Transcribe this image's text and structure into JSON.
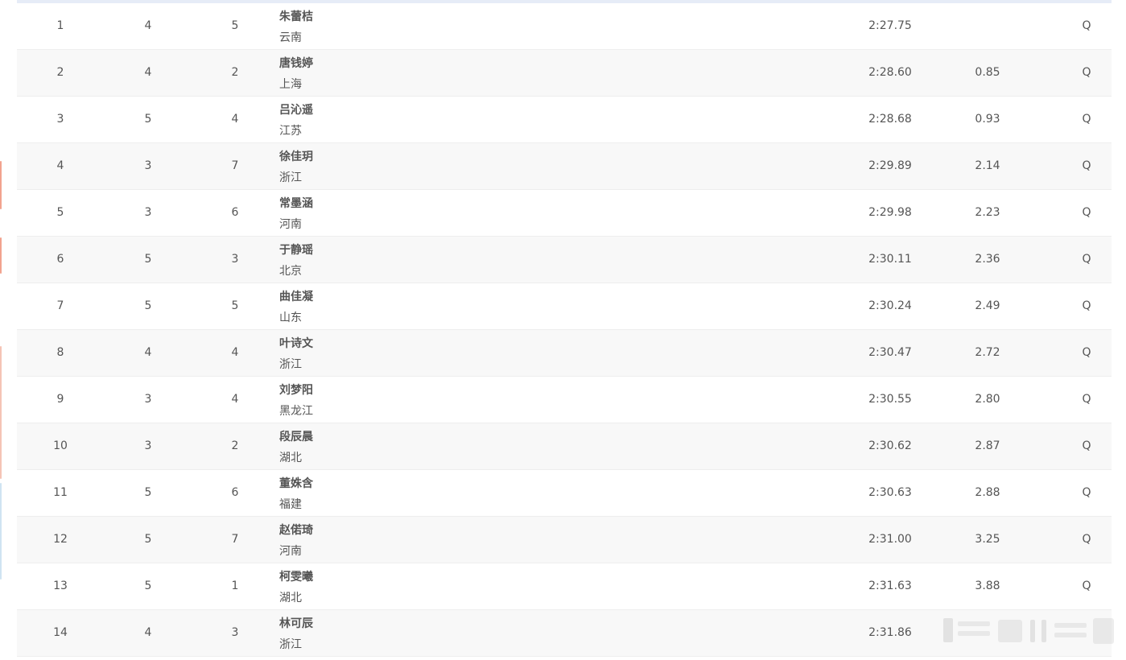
{
  "results": [
    {
      "rank": "1",
      "heat": "4",
      "lane": "5",
      "name": "朱蕾桔",
      "team": "云南",
      "time": "2:27.75",
      "diff": "",
      "qualify": "Q"
    },
    {
      "rank": "2",
      "heat": "4",
      "lane": "2",
      "name": "唐钱婷",
      "team": "上海",
      "time": "2:28.60",
      "diff": "0.85",
      "qualify": "Q"
    },
    {
      "rank": "3",
      "heat": "5",
      "lane": "4",
      "name": "吕沁遥",
      "team": "江苏",
      "time": "2:28.68",
      "diff": "0.93",
      "qualify": "Q"
    },
    {
      "rank": "4",
      "heat": "3",
      "lane": "7",
      "name": "徐佳玥",
      "team": "浙江",
      "time": "2:29.89",
      "diff": "2.14",
      "qualify": "Q"
    },
    {
      "rank": "5",
      "heat": "3",
      "lane": "6",
      "name": "常墨涵",
      "team": "河南",
      "time": "2:29.98",
      "diff": "2.23",
      "qualify": "Q"
    },
    {
      "rank": "6",
      "heat": "5",
      "lane": "3",
      "name": "于静瑶",
      "team": "北京",
      "time": "2:30.11",
      "diff": "2.36",
      "qualify": "Q"
    },
    {
      "rank": "7",
      "heat": "5",
      "lane": "5",
      "name": "曲佳凝",
      "team": "山东",
      "time": "2:30.24",
      "diff": "2.49",
      "qualify": "Q"
    },
    {
      "rank": "8",
      "heat": "4",
      "lane": "4",
      "name": "叶诗文",
      "team": "浙江",
      "time": "2:30.47",
      "diff": "2.72",
      "qualify": "Q"
    },
    {
      "rank": "9",
      "heat": "3",
      "lane": "4",
      "name": "刘梦阳",
      "team": "黑龙江",
      "time": "2:30.55",
      "diff": "2.80",
      "qualify": "Q"
    },
    {
      "rank": "10",
      "heat": "3",
      "lane": "2",
      "name": "段辰晨",
      "team": "湖北",
      "time": "2:30.62",
      "diff": "2.87",
      "qualify": "Q"
    },
    {
      "rank": "11",
      "heat": "5",
      "lane": "6",
      "name": "董姝含",
      "team": "福建",
      "time": "2:30.63",
      "diff": "2.88",
      "qualify": "Q"
    },
    {
      "rank": "12",
      "heat": "5",
      "lane": "7",
      "name": "赵偌琦",
      "team": "河南",
      "time": "2:31.00",
      "diff": "3.25",
      "qualify": "Q"
    },
    {
      "rank": "13",
      "heat": "5",
      "lane": "1",
      "name": "柯雯曦",
      "team": "湖北",
      "time": "2:31.63",
      "diff": "3.88",
      "qualify": "Q"
    },
    {
      "rank": "14",
      "heat": "4",
      "lane": "3",
      "name": "林可辰",
      "team": "浙江",
      "time": "2:31.86",
      "diff": "",
      "qualify": ""
    }
  ],
  "colors": {
    "row_alt": "#f8f8f8",
    "row_base": "#ffffff",
    "text": "#555555",
    "top_strip": "#e6ecf7",
    "left_decor_red": "#f2a38f",
    "left_decor_blue": "#cfe3f2"
  }
}
